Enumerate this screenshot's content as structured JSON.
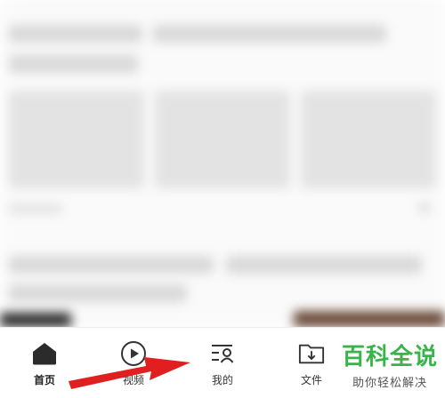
{
  "tabbar": {
    "tabs": [
      {
        "id": "home",
        "label": "首页",
        "icon": "home-icon",
        "active": true
      },
      {
        "id": "video",
        "label": "视频",
        "icon": "play-circle-icon",
        "active": false
      },
      {
        "id": "mine",
        "label": "我的",
        "icon": "profile-list-icon",
        "active": false
      },
      {
        "id": "files",
        "label": "文件",
        "icon": "download-folder-icon",
        "active": false
      }
    ]
  },
  "watermark": {
    "title": "百科全说",
    "slogan": "助你轻松解决"
  },
  "colors": {
    "watermark_green": "#3ab34a",
    "arrow_red": "#e02020"
  }
}
